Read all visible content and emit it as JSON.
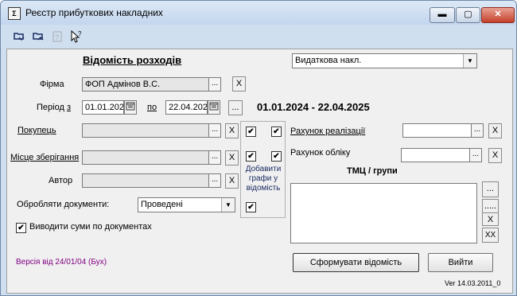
{
  "window": {
    "title": "Реєстр прибуткових накладних",
    "min": "▬",
    "max": "▢",
    "close": "✕"
  },
  "toolbar": {
    "icons": [
      "open-folder-icon",
      "save-folder-icon",
      "help-icon",
      "pointer-help-icon"
    ]
  },
  "form": {
    "heading": "Відомість розходів",
    "doc_type_select": "Видаткова накл.",
    "firm_label": "Фірма",
    "firm_value": "ФОП Адмінов В.С.",
    "period_label": "Період",
    "period_from_label": "з",
    "period_from": "01.01.202",
    "period_to_label": "по",
    "period_to": "22.04.202",
    "period_range_text": "01.01.2024 - 22.04.2025",
    "buyer_label": "Покупець",
    "storage_label": "Місце зберігання",
    "author_label": "Автор",
    "process_label": "Обробляти документи:",
    "process_value": "Проведені",
    "sums_checkbox_label": "Виводити суми по документах",
    "add_columns_label": "Добавити графи у відомість",
    "sales_account_label": "Рахунок реалізації",
    "accounting_account_label": "Рахунок обліку",
    "tmc_label": "ТМЦ  / групи",
    "version_text": "Версія від 24/01/04 (Бух)",
    "build_button": "Сформувати відомість",
    "exit_button": "Вийти",
    "ver_text": "Ver 14.03.2011_0",
    "ellipsis": "...",
    "ellipsis_long": ".....",
    "clear": "X",
    "clear_all": "XX",
    "check": "✔",
    "arrow": "▼"
  }
}
